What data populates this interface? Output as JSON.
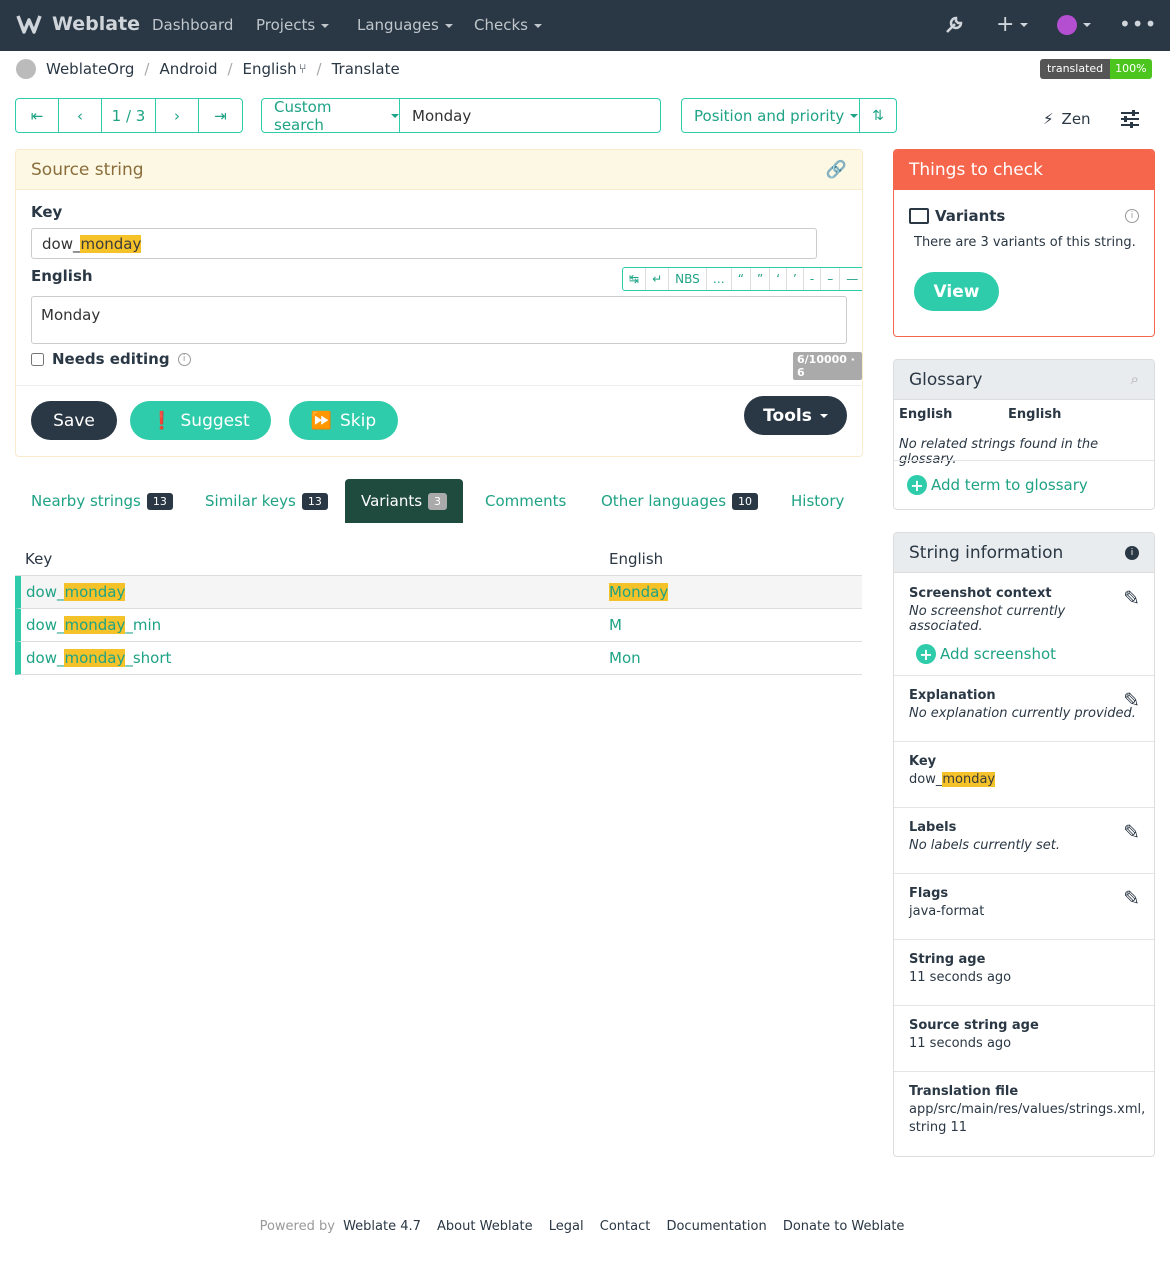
{
  "app": {
    "name": "Weblate"
  },
  "nav": {
    "dashboard": "Dashboard",
    "projects": "Projects",
    "languages": "Languages",
    "checks": "Checks"
  },
  "breadcrumb": {
    "project": "WeblateOrg",
    "component": "Android",
    "language": "English",
    "page": "Translate"
  },
  "status_badge": {
    "label": "translated",
    "value": "100%"
  },
  "pager": {
    "position": "1 / 3"
  },
  "search": {
    "type": "Custom search",
    "value": "Monday"
  },
  "sort": {
    "label": "Position and priority"
  },
  "zen": {
    "label": "Zen"
  },
  "source": {
    "title": "Source string",
    "key_label": "Key",
    "key_prefix": "dow_",
    "key_highlight": "monday",
    "language_label": "English",
    "text": "Monday",
    "needs_editing": "Needs editing",
    "counter": "6/10000 · 6",
    "special_chars": [
      "↹",
      "↵",
      "NBS",
      "…",
      "“",
      "”",
      "‘",
      "’",
      "-",
      "–",
      "—"
    ]
  },
  "buttons": {
    "save": "Save",
    "suggest": "Suggest",
    "skip": "Skip",
    "tools": "Tools"
  },
  "tabs": [
    {
      "label": "Nearby strings",
      "count": "13"
    },
    {
      "label": "Similar keys",
      "count": "13"
    },
    {
      "label": "Variants",
      "count": "3"
    },
    {
      "label": "Comments"
    },
    {
      "label": "Other languages",
      "count": "10"
    },
    {
      "label": "History"
    }
  ],
  "variants": {
    "headers": {
      "key": "Key",
      "english": "English"
    },
    "rows": [
      {
        "prefix": "dow_",
        "hl": "monday",
        "suffix": "",
        "english": "Monday"
      },
      {
        "prefix": "dow_",
        "hl": "monday",
        "suffix": "_min",
        "english": "M"
      },
      {
        "prefix": "dow_",
        "hl": "monday",
        "suffix": "_short",
        "english": "Mon"
      }
    ]
  },
  "checks": {
    "title": "Things to check",
    "item_title": "Variants",
    "item_text": "There are 3 variants of this string.",
    "view": "View"
  },
  "glossary": {
    "title": "Glossary",
    "col_source": "English",
    "col_target": "English",
    "empty": "No related strings found in the glossary.",
    "add": "Add term to glossary"
  },
  "info": {
    "title": "String information",
    "screenshot_title": "Screenshot context",
    "screenshot_text": "No screenshot currently associated.",
    "add_screenshot": "Add screenshot",
    "explanation_title": "Explanation",
    "explanation_text": "No explanation currently provided.",
    "key_title": "Key",
    "key_prefix": "dow_",
    "key_hl": "monday",
    "labels_title": "Labels",
    "labels_text": "No labels currently set.",
    "flags_title": "Flags",
    "flags_text": "java-format",
    "age_title": "String age",
    "age_text": "11 seconds ago",
    "src_age_title": "Source string age",
    "src_age_text": "11 seconds ago",
    "file_title": "Translation file",
    "file_text": "app/src/main/res/values/strings.xml,",
    "file_text2": "string 11"
  },
  "footer": {
    "powered": "Powered by",
    "version": "Weblate 4.7",
    "about": "About Weblate",
    "legal": "Legal",
    "contact": "Contact",
    "docs": "Documentation",
    "donate": "Donate to Weblate"
  }
}
